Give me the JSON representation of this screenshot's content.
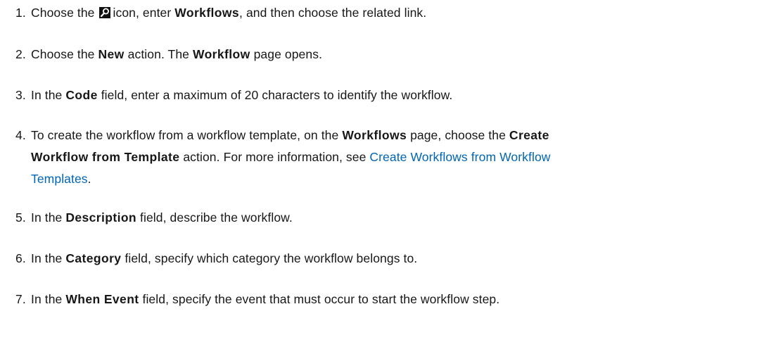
{
  "steps": [
    {
      "number": "1.",
      "parts": {
        "a": "Choose the",
        "icon": "search-icon",
        "b": "icon, enter",
        "bold1": "Workflows",
        "c": ", and then choose the related link."
      }
    },
    {
      "number": "2.",
      "parts": {
        "a": "Choose the",
        "bold1": "New",
        "b": "action. The",
        "bold2": "Workflow",
        "c": "page opens."
      }
    },
    {
      "number": "3.",
      "parts": {
        "a": "In the",
        "bold1": "Code",
        "b": "field, enter a maximum of 20 characters to identify the workflow."
      }
    },
    {
      "number": "4.",
      "parts": {
        "a": "To create the workflow from a workflow template, on the",
        "bold1": "Workflows",
        "b": "page, choose the",
        "bold2": "Create",
        "bold3": "Workflow from Template",
        "c": "action. For more information, see",
        "link1": "Create Workflows from Workflow",
        "link2": "Templates",
        "d": "."
      }
    },
    {
      "number": "5.",
      "parts": {
        "a": "In the",
        "bold1": "Description",
        "b": "field, describe the workflow."
      }
    },
    {
      "number": "6.",
      "parts": {
        "a": "In the",
        "bold1": "Category",
        "b": "field, specify which category the workflow belongs to."
      }
    },
    {
      "number": "7.",
      "parts": {
        "a": "In the",
        "bold1": "When Event",
        "b": "field, specify the event that must occur to start the workflow step."
      }
    }
  ]
}
